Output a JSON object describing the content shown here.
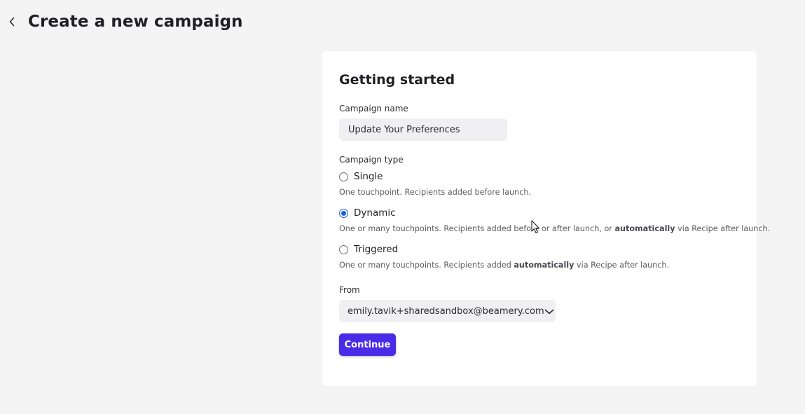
{
  "header": {
    "back_icon": "chevron-left-icon",
    "title": "Create a new campaign"
  },
  "form": {
    "section_title": "Getting started",
    "campaign_name": {
      "label": "Campaign name",
      "value": "Update Your Preferences"
    },
    "campaign_type": {
      "label": "Campaign type",
      "selected": "Dynamic",
      "options": [
        {
          "label": "Single",
          "desc_parts": [
            "One touchpoint. Recipients added before launch."
          ],
          "checked": false
        },
        {
          "label": "Dynamic",
          "desc_parts": [
            "One or many touchpoints. Recipients added before or after launch, or ",
            "automatically",
            " via Recipe after launch."
          ],
          "checked": true
        },
        {
          "label": "Triggered",
          "desc_parts": [
            "One or many touchpoints. Recipients added ",
            "automatically",
            " via Recipe after launch."
          ],
          "checked": false
        }
      ]
    },
    "from": {
      "label": "From",
      "value": "emily.tavik+sharedsandbox@beamery.com",
      "icon": "chevron-down-icon"
    },
    "continue_label": "Continue"
  },
  "colors": {
    "background": "#f4f4f4",
    "card": "#ffffff",
    "primary_button": "#4a2ce8",
    "radio_selected": "#1a5ed8",
    "input_bg": "#f0f0f2"
  }
}
